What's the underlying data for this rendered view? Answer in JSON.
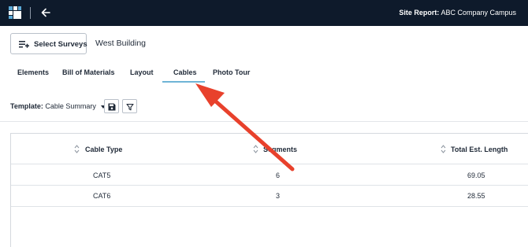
{
  "header": {
    "site_report_label": "Site Report:",
    "site_report_name": "ABC Company Campus"
  },
  "survey": {
    "select_label": "Select Surveys",
    "building": "West Building"
  },
  "tabs": [
    {
      "label": "Elements"
    },
    {
      "label": "Bill of Materials"
    },
    {
      "label": "Layout"
    },
    {
      "label": "Cables",
      "active": true
    },
    {
      "label": "Photo Tour"
    }
  ],
  "template": {
    "label": "Template:",
    "value": "Cable Summary"
  },
  "table": {
    "columns": [
      "Cable Type",
      "Segments",
      "Total Est. Length"
    ],
    "rows": [
      [
        "CAT5",
        "6",
        "69.05"
      ],
      [
        "CAT6",
        "3",
        "28.55"
      ]
    ]
  },
  "colors": {
    "topbar": "#0e1a2b",
    "active_tab_underline": "#6fb4d6",
    "annotation_arrow": "#e8412c"
  },
  "icons": [
    "app-logo-icon",
    "back-arrow-icon",
    "playlist-add-icon",
    "caret-down-icon",
    "save-icon",
    "filter-icon",
    "sort-icon"
  ]
}
